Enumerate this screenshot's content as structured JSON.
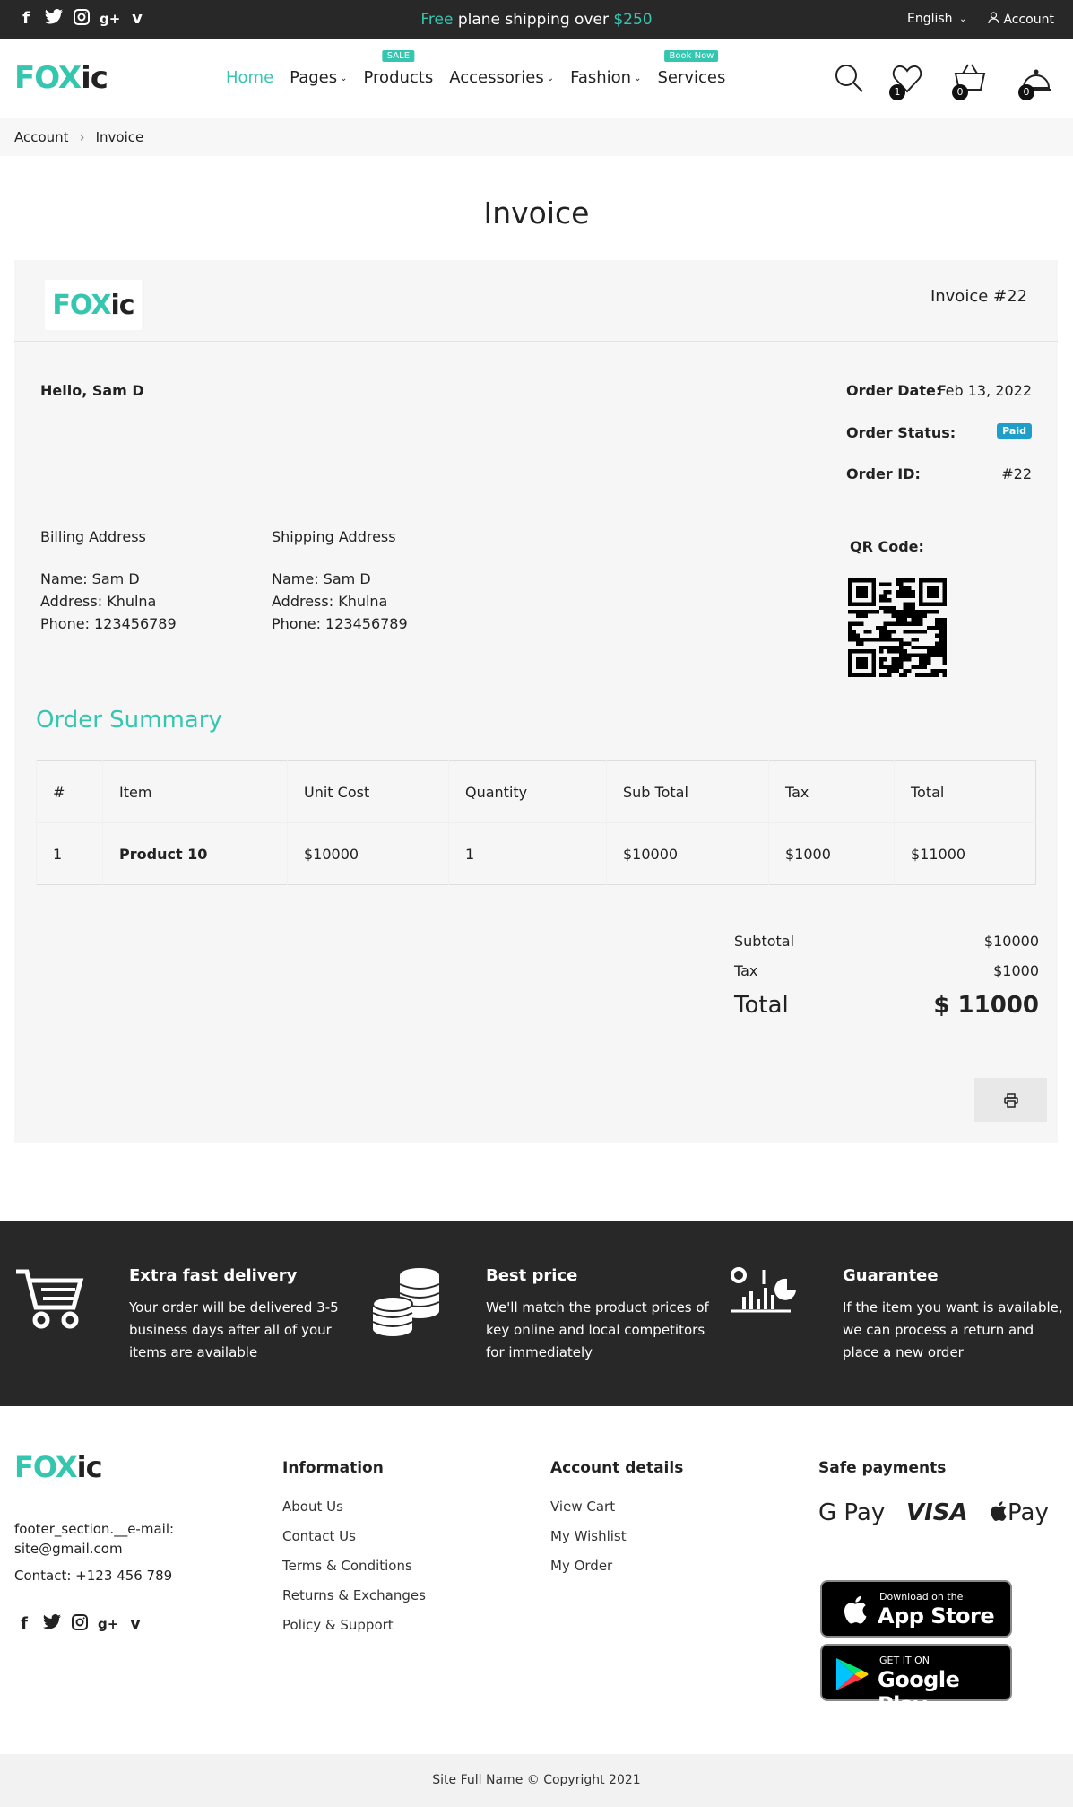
{
  "topbar": {
    "social": [
      "f",
      "t",
      "ig",
      "g+",
      "v"
    ],
    "promo_free": "Free",
    "promo_mid": " plane shipping over ",
    "promo_amount": "$250",
    "language": "English",
    "account": "Account"
  },
  "header": {
    "logo_part1": "FOX",
    "logo_part2": "ic",
    "nav": [
      {
        "label": "Home",
        "badge": "",
        "caret": false
      },
      {
        "label": "Pages",
        "badge": "",
        "caret": true
      },
      {
        "label": "Products",
        "badge": "SALE",
        "caret": false
      },
      {
        "label": "Accessories",
        "badge": "",
        "caret": true
      },
      {
        "label": "Fashion",
        "badge": "",
        "caret": true
      },
      {
        "label": "Services",
        "badge": "Book Now",
        "caret": false
      }
    ],
    "wishlist_count": "1",
    "cart_count": "0",
    "orders_count": "0"
  },
  "breadcrumb": {
    "account": "Account",
    "current": "Invoice"
  },
  "page_title": "Invoice",
  "invoice": {
    "number": "Invoice #22",
    "hello": "Hello, Sam D",
    "order_date_label": "Order Date:",
    "order_date": "Feb 13, 2022",
    "order_status_label": "Order Status:",
    "order_status": "Paid",
    "order_id_label": "Order ID:",
    "order_id": "#22",
    "billing": {
      "heading": "Billing Address",
      "name": "Name: Sam D",
      "address": "Address: Khulna",
      "phone": "Phone: 123456789"
    },
    "shipping": {
      "heading": "Shipping Address",
      "name": "Name: Sam D",
      "address": "Address: Khulna",
      "phone": "Phone: 123456789"
    },
    "qr_label": "QR Code:",
    "summary_title": "Order Summary",
    "columns": [
      "#",
      "Item",
      "Unit Cost",
      "Quantity",
      "Sub Total",
      "Tax",
      "Total"
    ],
    "rows": [
      [
        "1",
        "Product 10",
        "$10000",
        "1",
        "$10000",
        "$1000",
        "$11000"
      ]
    ],
    "subtotal_label": "Subtotal",
    "subtotal": "$10000",
    "tax_label": "Tax",
    "tax": "$1000",
    "total_label": "Total",
    "total": "$ 11000"
  },
  "features": [
    {
      "title": "Extra fast delivery",
      "desc": "Your order will be delivered 3-5 business days after all of your items are available",
      "icon": "cart-icon"
    },
    {
      "title": "Best price",
      "desc": "We'll match the product prices of key online and local competitors for immediately",
      "icon": "coins-icon"
    },
    {
      "title": "Guarantee",
      "desc": "If the item you want is available, we can process a return and place a new order",
      "icon": "analytics-icon"
    }
  ],
  "footer": {
    "email": "footer_section.__e-mail: site@gmail.com",
    "contact": "Contact: +123 456 789",
    "info_heading": "Information",
    "info_links": [
      "About Us",
      "Contact Us",
      "Terms & Conditions",
      "Returns & Exchanges",
      "Policy & Support"
    ],
    "account_heading": "Account details",
    "account_links": [
      "View Cart",
      "My Wishlist",
      "My Order"
    ],
    "payments_heading": "Safe payments",
    "gpay": "G Pay",
    "visa": "VISA",
    "applepay": "Pay",
    "appstore_small": "Download on the",
    "appstore_big": "App Store",
    "googleplay_small": "GET IT ON",
    "googleplay_big": "Google Play"
  },
  "copyright": "Site Full Name © Copyright 2021",
  "colors": {
    "accent": "#35c6b0",
    "dark": "#282828",
    "paid": "#1e9ec9"
  }
}
